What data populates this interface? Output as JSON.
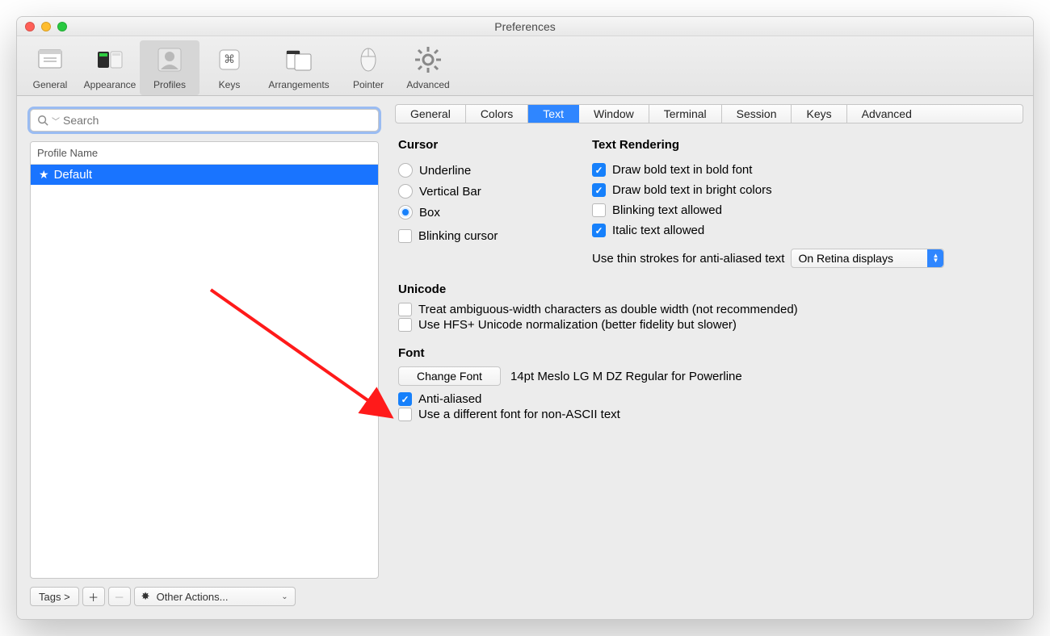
{
  "window": {
    "title": "Preferences"
  },
  "toolbar": {
    "items": [
      {
        "label": "General"
      },
      {
        "label": "Appearance"
      },
      {
        "label": "Profiles"
      },
      {
        "label": "Keys"
      },
      {
        "label": "Arrangements"
      },
      {
        "label": "Pointer"
      },
      {
        "label": "Advanced"
      }
    ]
  },
  "left": {
    "searchPlaceholder": "Search",
    "profileHeader": "Profile Name",
    "profileRow": "Default",
    "tagsLabel": "Tags >",
    "otherActions": "Other Actions..."
  },
  "tabs": [
    "General",
    "Colors",
    "Text",
    "Window",
    "Terminal",
    "Session",
    "Keys",
    "Advanced"
  ],
  "cursor": {
    "title": "Cursor",
    "opts": [
      "Underline",
      "Vertical Bar",
      "Box"
    ],
    "blinking": "Blinking cursor"
  },
  "render": {
    "title": "Text Rendering",
    "drawBoldFont": "Draw bold text in bold font",
    "drawBoldColors": "Draw bold text in bright colors",
    "blinkAllowed": "Blinking text allowed",
    "italicAllowed": "Italic text allowed",
    "thinStrokesLabel": "Use thin strokes for anti-aliased text",
    "thinStrokesValue": "On Retina displays"
  },
  "unicode": {
    "title": "Unicode",
    "ambiguous": "Treat ambiguous-width characters as double width (not recommended)",
    "hfs": "Use HFS+ Unicode normalization (better fidelity but slower)"
  },
  "font": {
    "title": "Font",
    "changeBtn": "Change Font",
    "current": "14pt Meslo LG M DZ Regular for Powerline",
    "antiAliased": "Anti-aliased",
    "nonAscii": "Use a different font for non-ASCII text"
  }
}
